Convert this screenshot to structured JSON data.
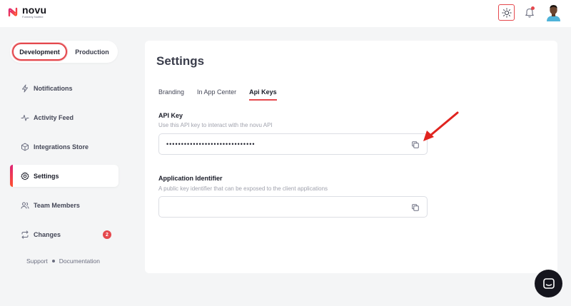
{
  "header": {
    "logo_name": "novu",
    "logo_subtitle": "Formerly Notifire",
    "icons": [
      "sun-icon",
      "bell-icon",
      "avatar"
    ]
  },
  "sidebar": {
    "environments": {
      "development": "Development",
      "production": "Production",
      "selected": "Development"
    },
    "items": [
      {
        "label": "Notifications",
        "icon": "lightning-icon"
      },
      {
        "label": "Activity Feed",
        "icon": "activity-icon"
      },
      {
        "label": "Integrations Store",
        "icon": "box-icon"
      },
      {
        "label": "Settings",
        "icon": "gear-icon",
        "active": true
      },
      {
        "label": "Team Members",
        "icon": "users-icon"
      },
      {
        "label": "Changes",
        "icon": "refresh-icon",
        "badge": "2"
      }
    ],
    "footer": {
      "support": "Support",
      "documentation": "Documentation"
    }
  },
  "main": {
    "title": "Settings",
    "tabs": [
      {
        "label": "Branding"
      },
      {
        "label": "In App Center"
      },
      {
        "label": "Api Keys",
        "active": true
      }
    ],
    "api_key": {
      "label": "API Key",
      "help": "Use this API key to interact with the novu API",
      "value": "••••••••••••••••••••••••••••••"
    },
    "app_identifier": {
      "label": "Application Identifier",
      "help": "A public key identifier that can be exposed to the client applications",
      "value": ""
    }
  },
  "colors": {
    "accent": "#e5484d",
    "background": "#f4f5f6",
    "card": "#ffffff",
    "chat_button": "#15151d"
  }
}
